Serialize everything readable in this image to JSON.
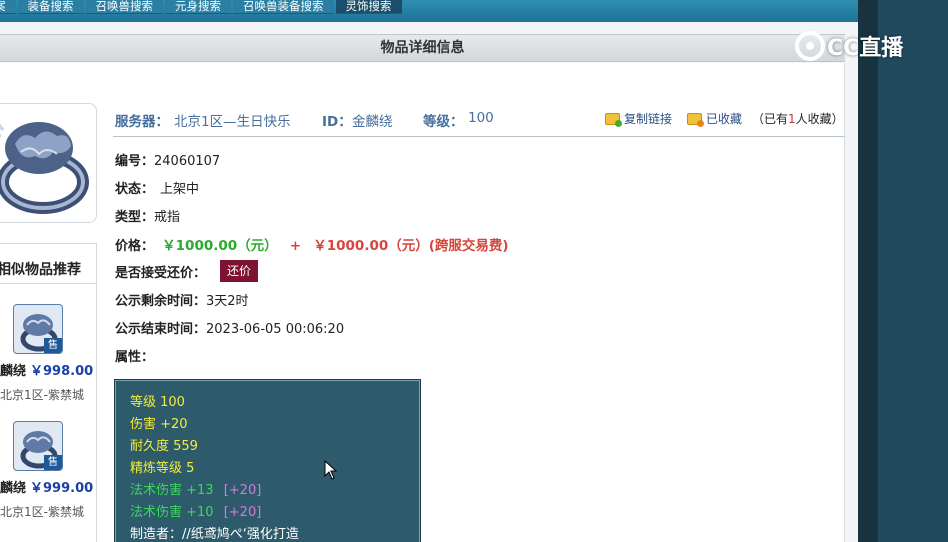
{
  "nav": {
    "tabs": [
      {
        "label": "案"
      },
      {
        "label": "装备搜索"
      },
      {
        "label": "召唤兽搜索"
      },
      {
        "label": "元身搜索"
      },
      {
        "label": "召唤兽装备搜索"
      },
      {
        "label": "灵饰搜索"
      }
    ]
  },
  "page_title": "物品详细信息",
  "header": {
    "server_label": "服务器：",
    "server_value": "北京1区—生日快乐",
    "id_label": "ID：",
    "id_value": "金麟绕",
    "level_label": "等级：",
    "level_value": "100",
    "copy_link": "复制链接",
    "favorited": "已收藏",
    "fav_prefix": "（已有",
    "fav_count": "1",
    "fav_suffix": "人收藏）"
  },
  "details": {
    "serial_label": "编号：",
    "serial_value": "24060107",
    "status_label": "状态：",
    "status_value": "上架中",
    "type_label": "类型：",
    "type_value": "戒指",
    "price_label": "价格：",
    "price_value": "￥1000.00（元）",
    "price_plus": "+",
    "price_fee": "￥1000.00（元）(跨服交易费)",
    "bargain_label": "是否接受还价：",
    "bargain_button": "还价",
    "remaining_label": "公示剩余时间：",
    "remaining_value": "3天2时",
    "end_label": "公示结束时间：",
    "end_value": "2023-06-05 00:06:20",
    "attr_label": "属性："
  },
  "attributes": {
    "level": "等级 100",
    "damage": "伤害 +20",
    "durability": "耐久度 559",
    "refine": "精炼等级 5",
    "spell1": "法术伤害 +13",
    "spell1_extra": "[+20]",
    "spell2": "法术伤害 +10",
    "spell2_extra": "[+20]",
    "maker": "制造者：//纸鸢鸠ぺ‘强化打造"
  },
  "similar": {
    "title": "相似物品推荐",
    "sale_badge": "售",
    "items": [
      {
        "name": "麟绕",
        "price": "￥998.00",
        "server": "北京1区-紫禁城"
      },
      {
        "name": "麟绕",
        "price": "￥999.00",
        "server": "北京1区-紫禁城"
      }
    ]
  },
  "watermark": "CC直播",
  "colors": {
    "nav_bg": "#2e8fb2",
    "label_blue": "#466f9c",
    "price_green": "#2bab2b",
    "price_red": "#d7443c",
    "bargain_bg": "#7d1330",
    "attr_bg": "#2e5b6b"
  }
}
